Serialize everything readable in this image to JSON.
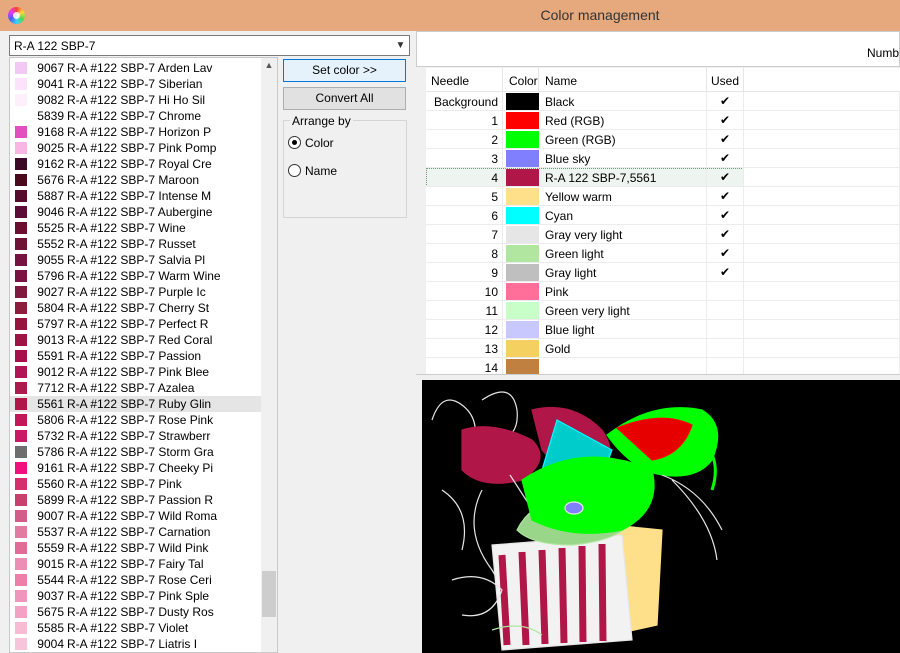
{
  "window": {
    "title": "Color management"
  },
  "thread_combo": {
    "value": "R-A 122 SBP-7"
  },
  "thread_list": [
    {
      "code": "9067",
      "name": "R-A #122 SBP-7 Arden Lav",
      "color": "#f2c8f4"
    },
    {
      "code": "9041",
      "name": "R-A #122 SBP-7 Siberian",
      "color": "#fbe3fb"
    },
    {
      "code": "9082",
      "name": "R-A #122 SBP-7 Hi Ho Sil",
      "color": "#fdf0fb"
    },
    {
      "code": "5839",
      "name": "R-A #122 SBP-7 Chrome",
      "color": "#ffffff"
    },
    {
      "code": "9168",
      "name": "R-A #122 SBP-7 Horizon P",
      "color": "#e34fbe"
    },
    {
      "code": "9025",
      "name": "R-A #122 SBP-7 Pink Pomp",
      "color": "#f7b6e3"
    },
    {
      "code": "9162",
      "name": "R-A #122 SBP-7 Royal Cre",
      "color": "#3a0a26"
    },
    {
      "code": "5676",
      "name": "R-A #122 SBP-7 Maroon",
      "color": "#4a0a1e"
    },
    {
      "code": "5887",
      "name": "R-A #122 SBP-7 Intense M",
      "color": "#560c2c"
    },
    {
      "code": "9046",
      "name": "R-A #122 SBP-7 Aubergine",
      "color": "#5c0d37"
    },
    {
      "code": "5525",
      "name": "R-A #122 SBP-7 Wine",
      "color": "#6b0e30"
    },
    {
      "code": "5552",
      "name": "R-A #122 SBP-7 Russet",
      "color": "#6e1236"
    },
    {
      "code": "9055",
      "name": "R-A #122 SBP-7 Salvia Pl",
      "color": "#751440"
    },
    {
      "code": "5796",
      "name": "R-A #122 SBP-7 Warm Wine",
      "color": "#7a1242"
    },
    {
      "code": "9027",
      "name": "R-A #122 SBP-7 Purple Ic",
      "color": "#7e1a3f"
    },
    {
      "code": "5804",
      "name": "R-A #122 SBP-7 Cherry St",
      "color": "#8e1c3c"
    },
    {
      "code": "5797",
      "name": "R-A #122 SBP-7 Perfect R",
      "color": "#96143e"
    },
    {
      "code": "9013",
      "name": "R-A #122 SBP-7 Red Coral",
      "color": "#9e1444"
    },
    {
      "code": "5591",
      "name": "R-A #122 SBP-7 Passion",
      "color": "#a8104c"
    },
    {
      "code": "9012",
      "name": "R-A #122 SBP-7 Pink Blee",
      "color": "#b21556"
    },
    {
      "code": "7712",
      "name": "R-A #122 SBP-7 Azalea",
      "color": "#ac1a4e"
    },
    {
      "code": "5561",
      "name": "R-A #122 SBP-7 Ruby Glin",
      "color": "#b01648"
    },
    {
      "code": "5806",
      "name": "R-A #122 SBP-7 Rose Pink",
      "color": "#c2185a"
    },
    {
      "code": "5732",
      "name": "R-A #122 SBP-7 Strawberr",
      "color": "#c91a66"
    },
    {
      "code": "5786",
      "name": "R-A #122 SBP-7 Storm Gra",
      "color": "#6e6e6e"
    },
    {
      "code": "9161",
      "name": "R-A #122 SBP-7 Cheeky Pi",
      "color": "#f0107e"
    },
    {
      "code": "5560",
      "name": "R-A #122 SBP-7 Pink",
      "color": "#d5306e"
    },
    {
      "code": "5899",
      "name": "R-A #122 SBP-7 Passion R",
      "color": "#c8406e"
    },
    {
      "code": "9007",
      "name": "R-A #122 SBP-7 Wild Roma",
      "color": "#d45c8a"
    },
    {
      "code": "5537",
      "name": "R-A #122 SBP-7 Carnation",
      "color": "#e07ca2"
    },
    {
      "code": "5559",
      "name": "R-A #122 SBP-7 Wild Pink",
      "color": "#e26b97"
    },
    {
      "code": "9015",
      "name": "R-A #122 SBP-7 Fairy Tal",
      "color": "#ec8fb4"
    },
    {
      "code": "5544",
      "name": "R-A #122 SBP-7 Rose Ceri",
      "color": "#ee7fa9"
    },
    {
      "code": "9037",
      "name": "R-A #122 SBP-7 Pink Sple",
      "color": "#f095bb"
    },
    {
      "code": "5675",
      "name": "R-A #122 SBP-7 Dusty Ros",
      "color": "#f4a2c4"
    },
    {
      "code": "5585",
      "name": "R-A #122 SBP-7 Violet",
      "color": "#f7bcd4"
    },
    {
      "code": "9004",
      "name": "R-A #122 SBP-7 Liatris I",
      "color": "#f8c4da"
    }
  ],
  "thread_list_selected_index": 21,
  "buttons": {
    "set_color": "Set color >>",
    "convert_all": "Convert All"
  },
  "arrange": {
    "legend": "Arrange by",
    "color": "Color",
    "name": "Name",
    "selected": "color"
  },
  "header_strip": {
    "label": "Numb"
  },
  "table": {
    "columns": {
      "needle": "Needle",
      "color": "Color",
      "name": "Name",
      "used": "Used"
    },
    "rows": [
      {
        "needle": "Background",
        "color": "#000000",
        "name": "Black",
        "used": "✔"
      },
      {
        "needle": "1",
        "color": "#ff0000",
        "name": "Red (RGB)",
        "used": "✔"
      },
      {
        "needle": "2",
        "color": "#00ff00",
        "name": "Green (RGB)",
        "used": "✔"
      },
      {
        "needle": "3",
        "color": "#8080ff",
        "name": "Blue sky",
        "used": "✔"
      },
      {
        "needle": "4",
        "color": "#b01648",
        "name": "R-A 122 SBP-7,5561",
        "used": "✔"
      },
      {
        "needle": "5",
        "color": "#ffe08a",
        "name": "Yellow warm",
        "used": "✔"
      },
      {
        "needle": "6",
        "color": "#00ffff",
        "name": "Cyan",
        "used": "✔"
      },
      {
        "needle": "7",
        "color": "#e6e6e6",
        "name": "Gray very light",
        "used": "✔"
      },
      {
        "needle": "8",
        "color": "#b0e6a0",
        "name": "Green light",
        "used": "✔"
      },
      {
        "needle": "9",
        "color": "#bfbfbf",
        "name": "Gray light",
        "used": "✔"
      },
      {
        "needle": "10",
        "color": "#ff6f9a",
        "name": "Pink",
        "used": ""
      },
      {
        "needle": "11",
        "color": "#c8ffc8",
        "name": "Green very light",
        "used": ""
      },
      {
        "needle": "12",
        "color": "#c8c8ff",
        "name": "Blue light",
        "used": ""
      },
      {
        "needle": "13",
        "color": "#f4d060",
        "name": "Gold",
        "used": ""
      },
      {
        "needle": "14",
        "color": "#c08040",
        "name": "",
        "used": ""
      }
    ],
    "selected_index": 4
  }
}
